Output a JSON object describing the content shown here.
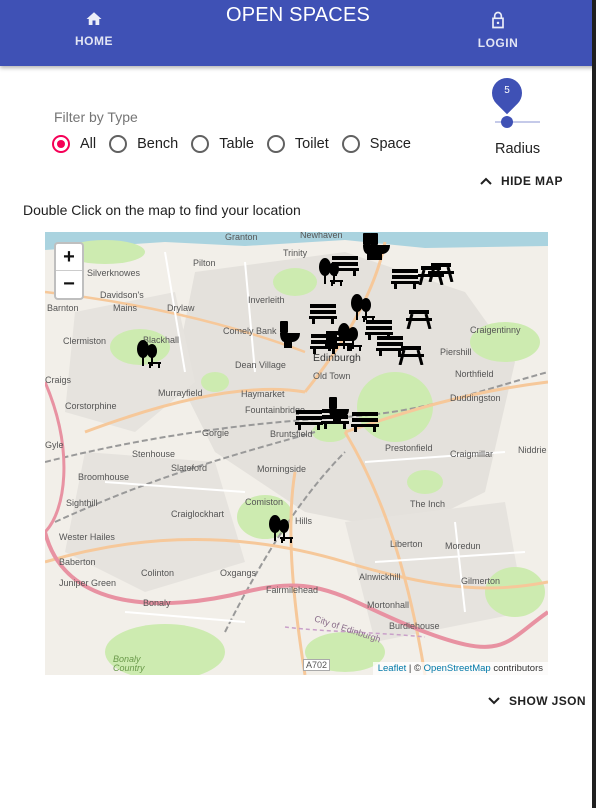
{
  "app": {
    "title": "OPEN SPACES",
    "nav": {
      "home_label": "HOME",
      "login_label": "LOGIN",
      "home_icon": "home-icon",
      "login_icon": "lock-icon"
    }
  },
  "filter": {
    "label": "Filter by Type",
    "selected": "All",
    "options": [
      "All",
      "Bench",
      "Table",
      "Toilet",
      "Space"
    ]
  },
  "radius": {
    "value": "5",
    "label": "Radius"
  },
  "buttons": {
    "hide_map": "HIDE MAP",
    "show_json": "SHOW JSON"
  },
  "map": {
    "hint": "Double Click on the map to find your location",
    "zoom_in": "+",
    "zoom_out": "−",
    "attribution": {
      "leaflet": "Leaflet",
      "sep": " | © ",
      "osm": "OpenStreetMap",
      "suffix": " contributors"
    },
    "places": [
      "Granton",
      "Newhaven",
      "Trinity",
      "Pilton",
      "Silverknowes",
      "Davidson's",
      "Mains",
      "Drylaw",
      "Barnton",
      "Inverleith",
      "Craigentinny",
      "Comely Bank",
      "Clermiston",
      "Blackhall",
      "Dean Village",
      "Edinburgh",
      "Piershill",
      "Northfield",
      "Old Town",
      "Murrayfield",
      "Craigs",
      "Haymarket",
      "Duddingston",
      "Corstorphine",
      "Fountainbridge",
      "Gyle",
      "Gorgie",
      "Bruntsfield",
      "Prestonfield",
      "Craigmillar",
      "Niddrie",
      "Stenhouse",
      "Slateford",
      "Morningside",
      "Broomhouse",
      "Sighthill",
      "Comiston",
      "The Inch",
      "Craiglockhart",
      "Hills",
      "Wester Hailes",
      "Liberton",
      "Moredun",
      "Baberton",
      "Colinton",
      "Oxgangs",
      "Alnwickhill",
      "Gilmerton",
      "Juniper Green",
      "Fairmilehead",
      "Bonaly",
      "Mortonhall",
      "Burdiehouse",
      "City of Edinburgh",
      "A702",
      "Bonaly Country"
    ],
    "colors": {
      "land": "#f2efe9",
      "park": "#cdebb0",
      "water": "#aad3df",
      "road_major": "#f6c89a",
      "road_trunk": "#e892a2",
      "rail": "#999999",
      "urban": "#e0dfdf"
    }
  },
  "markers": [
    {
      "type": "Toilet"
    },
    {
      "type": "Bench"
    },
    {
      "type": "Table"
    },
    {
      "type": "Space"
    },
    {
      "type": "Bench"
    },
    {
      "type": "Table"
    },
    {
      "type": "Bench"
    },
    {
      "type": "Space"
    },
    {
      "type": "Toilet"
    },
    {
      "type": "Bench"
    },
    {
      "type": "Bench"
    },
    {
      "type": "Space"
    },
    {
      "type": "Table"
    },
    {
      "type": "Table"
    },
    {
      "type": "Bench"
    },
    {
      "type": "Toilet"
    },
    {
      "type": "Bench"
    },
    {
      "type": "Toilet"
    },
    {
      "type": "Bench"
    },
    {
      "type": "Space"
    },
    {
      "type": "Space"
    },
    {
      "type": "Bench"
    },
    {
      "type": "Bench"
    }
  ],
  "theme": {
    "primary": "#3f51b5",
    "accent": "#f50057"
  }
}
